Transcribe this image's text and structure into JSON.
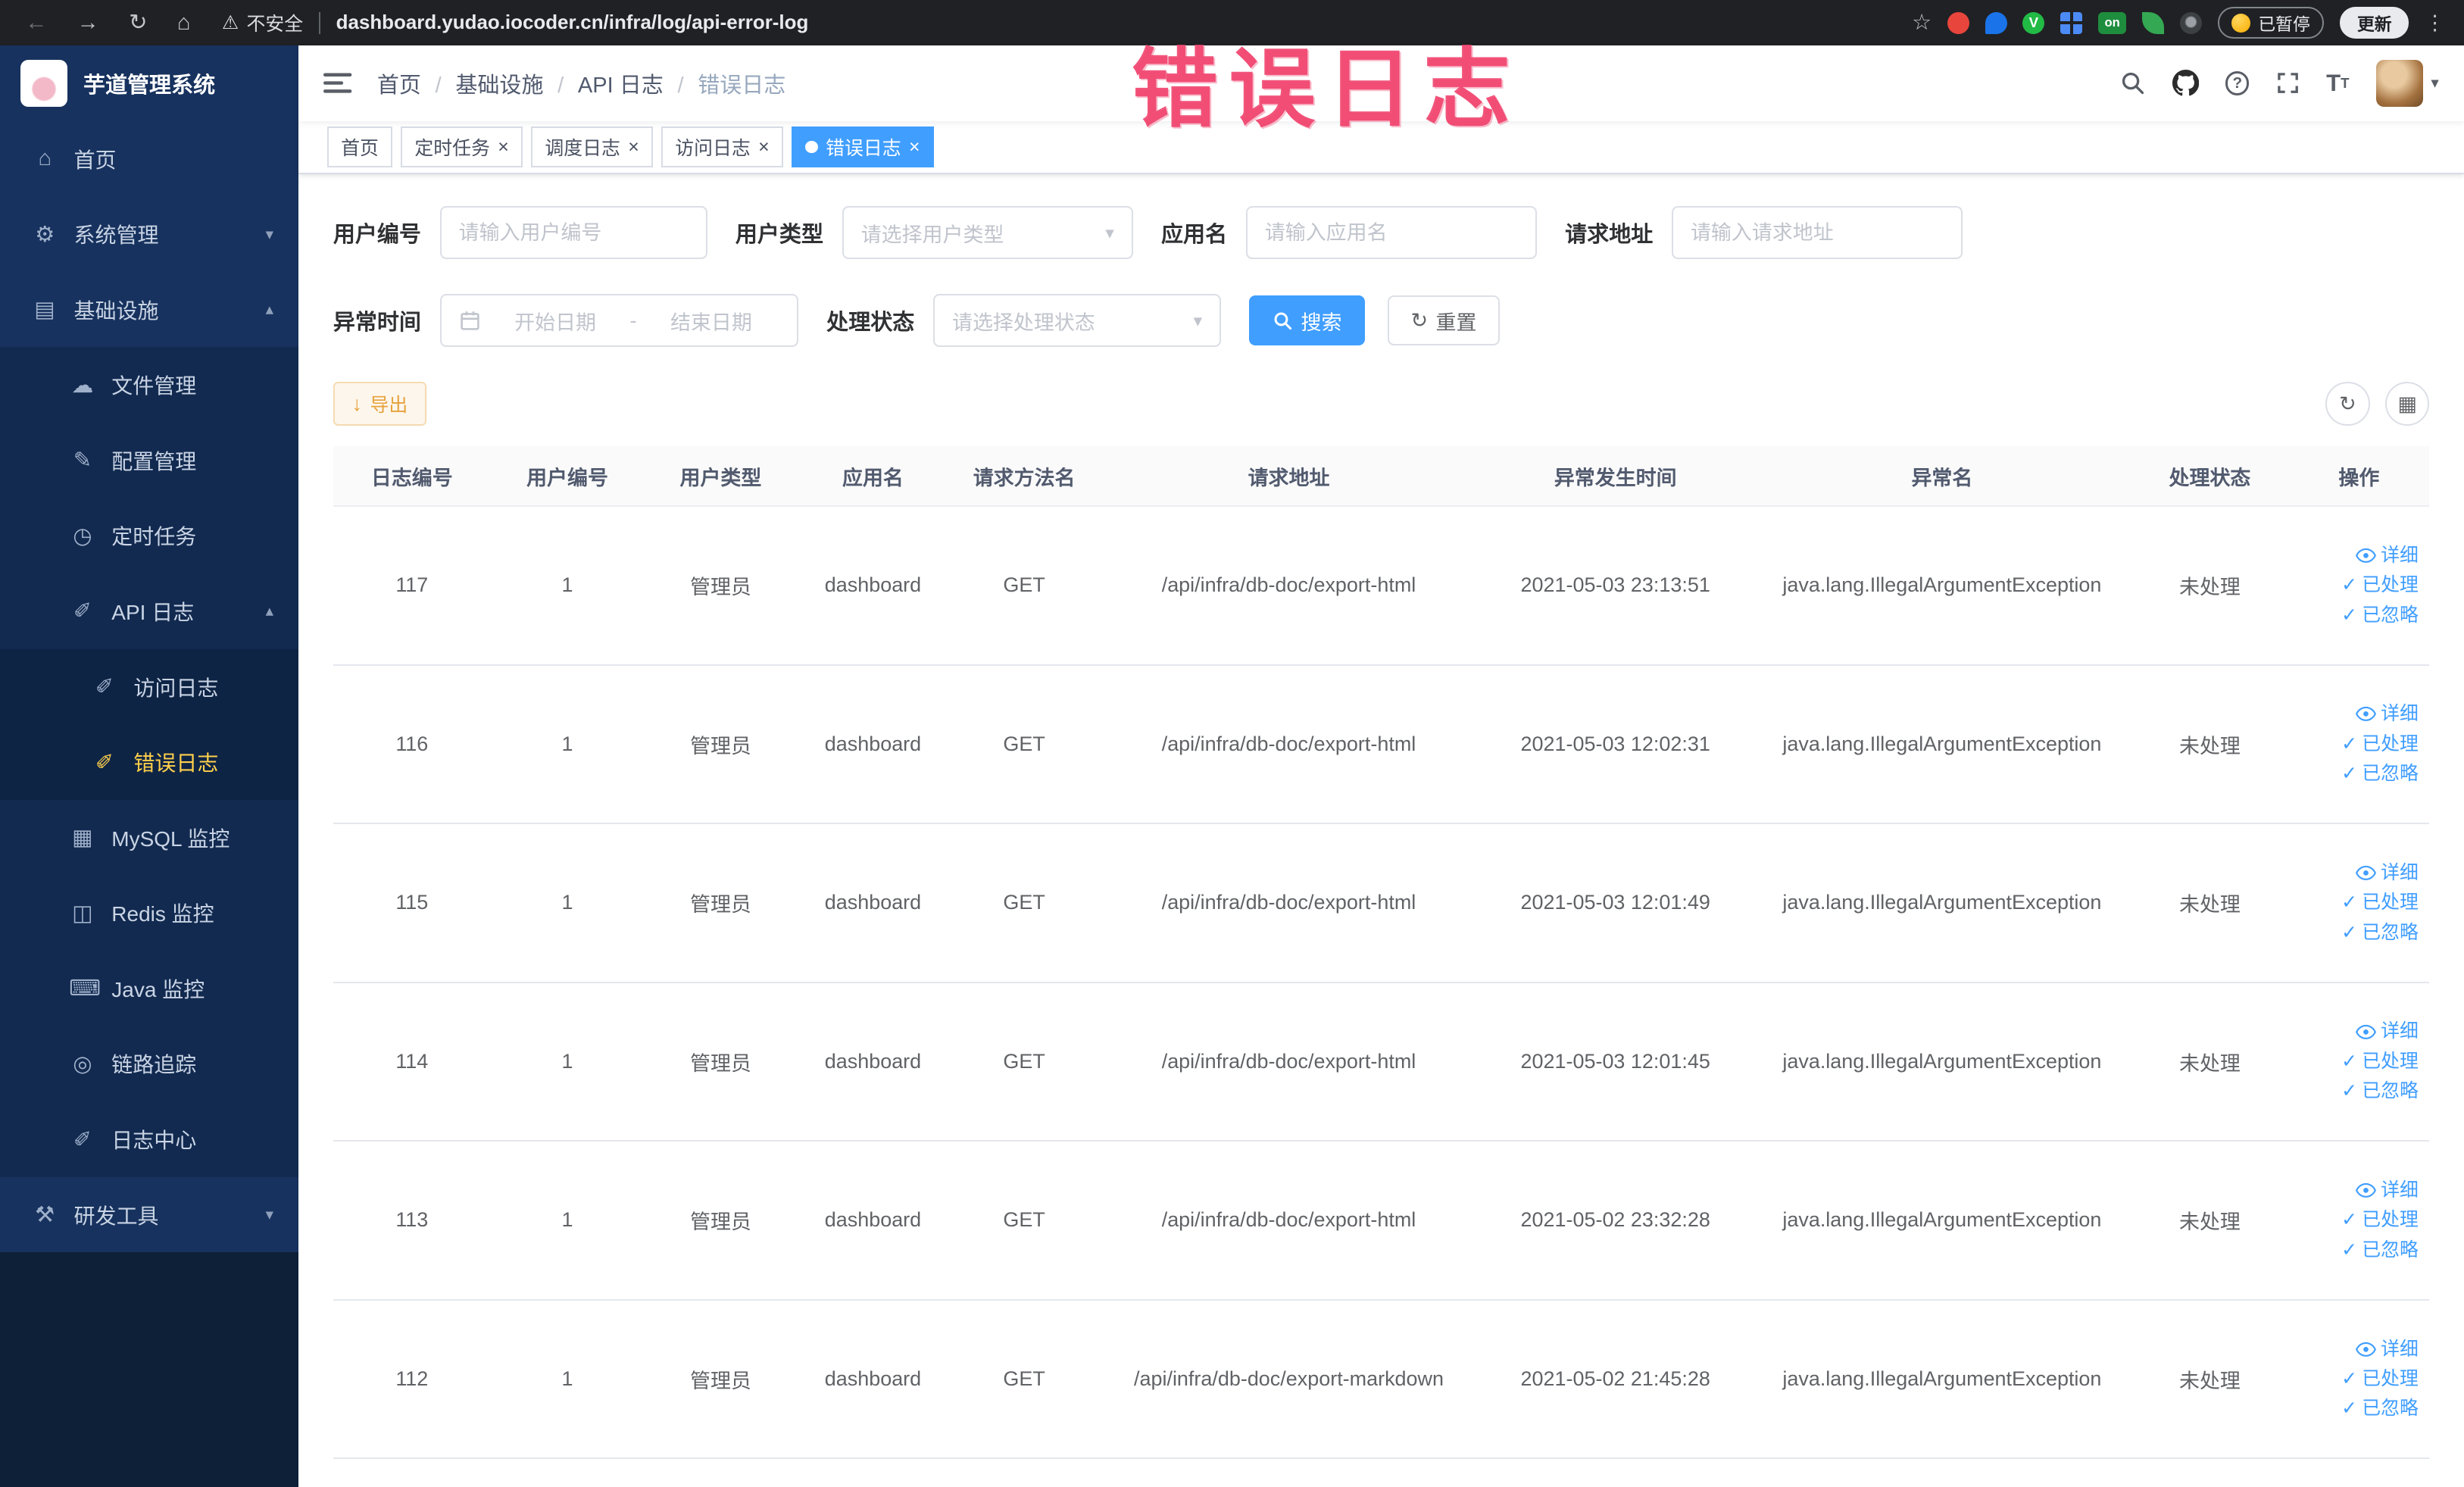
{
  "browser": {
    "warning_text": "不安全",
    "url": "dashboard.yudao.iocoder.cn/infra/log/api-error-log",
    "v_badge": "V",
    "on_badge": "on",
    "paused_badge": "已暂停",
    "update_button": "更新"
  },
  "annotation": {
    "text": "错误日志"
  },
  "sidebar": {
    "logo_title": "芋道管理系统",
    "items": [
      {
        "label": "首页",
        "icon": "home",
        "level": 1
      },
      {
        "label": "系统管理",
        "icon": "gear",
        "level": 1,
        "chevron": "down"
      },
      {
        "label": "基础设施",
        "icon": "monitor",
        "level": 1,
        "chevron": "up"
      },
      {
        "label": "文件管理",
        "icon": "cloud",
        "level": 2
      },
      {
        "label": "配置管理",
        "icon": "edit",
        "level": 2
      },
      {
        "label": "定时任务",
        "icon": "timer",
        "level": 2
      },
      {
        "label": "API 日志",
        "icon": "log",
        "level": 2,
        "chevron": "up"
      },
      {
        "label": "访问日志",
        "icon": "log",
        "level": 3
      },
      {
        "label": "错误日志",
        "icon": "log",
        "level": 3,
        "active": true
      },
      {
        "label": "MySQL 监控",
        "icon": "table",
        "level": 2
      },
      {
        "label": "Redis 监控",
        "icon": "db",
        "level": 2
      },
      {
        "label": "Java 监控",
        "icon": "keyboard",
        "level": 2
      },
      {
        "label": "链路追踪",
        "icon": "target",
        "level": 2
      },
      {
        "label": "日志中心",
        "icon": "log",
        "level": 2
      },
      {
        "label": "研发工具",
        "icon": "tools",
        "level": 1,
        "chevron": "down"
      }
    ]
  },
  "breadcrumb": [
    "首页",
    "基础设施",
    "API 日志",
    "错误日志"
  ],
  "tabs": [
    {
      "label": "首页"
    },
    {
      "label": "定时任务",
      "closable": true
    },
    {
      "label": "调度日志",
      "closable": true
    },
    {
      "label": "访问日志",
      "closable": true
    },
    {
      "label": "错误日志",
      "closable": true,
      "active": true
    }
  ],
  "filters": {
    "user_id": {
      "label": "用户编号",
      "placeholder": "请输入用户编号"
    },
    "user_type": {
      "label": "用户类型",
      "placeholder": "请选择用户类型"
    },
    "app_name": {
      "label": "应用名",
      "placeholder": "请输入应用名"
    },
    "request_url": {
      "label": "请求地址",
      "placeholder": "请输入请求地址"
    },
    "exception_time": {
      "label": "异常时间",
      "start_placeholder": "开始日期",
      "separator": "-",
      "end_placeholder": "结束日期"
    },
    "process_status": {
      "label": "处理状态",
      "placeholder": "请选择处理状态"
    },
    "search_button": "搜索",
    "reset_button": "重置"
  },
  "toolbar": {
    "export_button": "导出"
  },
  "table": {
    "headers": [
      "日志编号",
      "用户编号",
      "用户类型",
      "应用名",
      "请求方法名",
      "请求地址",
      "异常发生时间",
      "异常名",
      "处理状态",
      "操作"
    ],
    "actions": {
      "detail": "详细",
      "processed": "已处理",
      "ignored": "已忽略"
    },
    "rows": [
      {
        "id": "117",
        "user_id": "1",
        "user_type": "管理员",
        "app_name": "dashboard",
        "method": "GET",
        "url": "/api/infra/db-doc/export-html",
        "time": "2021-05-03 23:13:51",
        "exception": "java.lang.IllegalArgumentException",
        "status": "未处理"
      },
      {
        "id": "116",
        "user_id": "1",
        "user_type": "管理员",
        "app_name": "dashboard",
        "method": "GET",
        "url": "/api/infra/db-doc/export-html",
        "time": "2021-05-03 12:02:31",
        "exception": "java.lang.IllegalArgumentException",
        "status": "未处理"
      },
      {
        "id": "115",
        "user_id": "1",
        "user_type": "管理员",
        "app_name": "dashboard",
        "method": "GET",
        "url": "/api/infra/db-doc/export-html",
        "time": "2021-05-03 12:01:49",
        "exception": "java.lang.IllegalArgumentException",
        "status": "未处理"
      },
      {
        "id": "114",
        "user_id": "1",
        "user_type": "管理员",
        "app_name": "dashboard",
        "method": "GET",
        "url": "/api/infra/db-doc/export-html",
        "time": "2021-05-03 12:01:45",
        "exception": "java.lang.IllegalArgumentException",
        "status": "未处理"
      },
      {
        "id": "113",
        "user_id": "1",
        "user_type": "管理员",
        "app_name": "dashboard",
        "method": "GET",
        "url": "/api/infra/db-doc/export-html",
        "time": "2021-05-02 23:32:28",
        "exception": "java.lang.IllegalArgumentException",
        "status": "未处理"
      },
      {
        "id": "112",
        "user_id": "1",
        "user_type": "管理员",
        "app_name": "dashboard",
        "method": "GET",
        "url": "/api/infra/db-doc/export-markdown",
        "time": "2021-05-02 21:45:28",
        "exception": "java.lang.IllegalArgumentException",
        "status": "未处理"
      }
    ]
  }
}
